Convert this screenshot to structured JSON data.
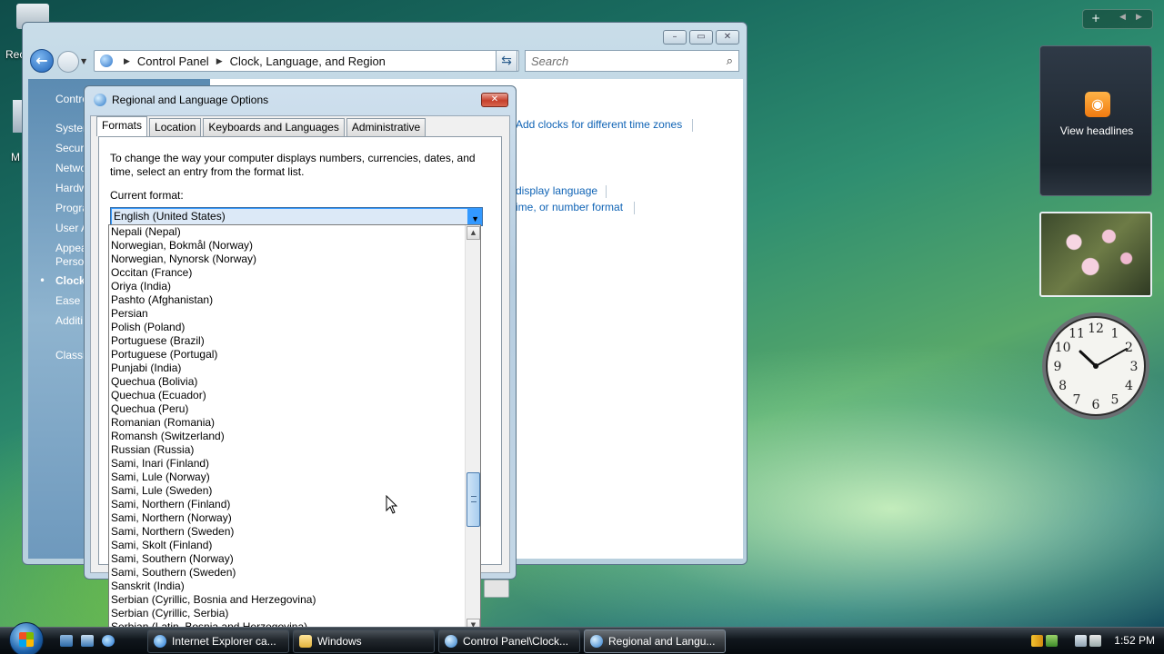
{
  "desktop": {
    "recycle_bin_label": "Rec",
    "icon2_label": "M"
  },
  "explorer": {
    "address": {
      "segments": [
        "Control Panel",
        "Clock, Language, and Region"
      ]
    },
    "search_placeholder": "Search",
    "left_pane": {
      "items": [
        {
          "label": "Contro"
        },
        {
          "label": "Syster"
        },
        {
          "label": "Securi"
        },
        {
          "label": "Netwo"
        },
        {
          "label": "Hardw"
        },
        {
          "label": "Progra"
        },
        {
          "label": "User A"
        },
        {
          "label": "Appea"
        },
        {
          "label": "Persor"
        },
        {
          "label": "Clock,"
        },
        {
          "label": "Ease o"
        },
        {
          "label": "Additi"
        },
        {
          "label": "Classi"
        }
      ]
    },
    "content_links": {
      "add_clocks": "Add clocks for different time zones",
      "display_language": "display language",
      "number_format": "ime, or number format"
    }
  },
  "dialog": {
    "title": "Regional and Language Options",
    "tabs": [
      "Formats",
      "Location",
      "Keyboards and Languages",
      "Administrative"
    ],
    "description": "To change the way your computer displays numbers, currencies, dates, and time, select an entry from the format list.",
    "current_format_label": "Current format:",
    "current_format_value": "English (United States)"
  },
  "format_list": {
    "options": [
      "Nepali (Nepal)",
      "Norwegian, Bokmål (Norway)",
      "Norwegian, Nynorsk (Norway)",
      "Occitan (France)",
      "Oriya (India)",
      "Pashto (Afghanistan)",
      "Persian",
      "Polish (Poland)",
      "Portuguese (Brazil)",
      "Portuguese (Portugal)",
      "Punjabi (India)",
      "Quechua (Bolivia)",
      "Quechua (Ecuador)",
      "Quechua (Peru)",
      "Romanian (Romania)",
      "Romansh (Switzerland)",
      "Russian (Russia)",
      "Sami, Inari (Finland)",
      "Sami, Lule (Norway)",
      "Sami, Lule (Sweden)",
      "Sami, Northern (Finland)",
      "Sami, Northern (Norway)",
      "Sami, Northern (Sweden)",
      "Sami, Skolt (Finland)",
      "Sami, Southern (Norway)",
      "Sami, Southern (Sweden)",
      "Sanskrit (India)",
      "Serbian (Cyrillic, Bosnia and Herzegovina)",
      "Serbian (Cyrillic, Serbia)",
      "Serbian (Latin, Bosnia and Herzegovina)"
    ]
  },
  "gadgets": {
    "feed_label": "View headlines",
    "clock_numbers": [
      "12",
      "1",
      "2",
      "3",
      "4",
      "5",
      "6",
      "7",
      "8",
      "9",
      "10",
      "11"
    ]
  },
  "taskbar": {
    "buttons": [
      {
        "label": "Internet Explorer ca..."
      },
      {
        "label": "Windows"
      },
      {
        "label": "Control Panel\\Clock..."
      },
      {
        "label": "Regional and Langu..."
      }
    ],
    "time": "1:52 PM"
  },
  "colors": {
    "link": "#0f63b5",
    "selection": "#3399ff",
    "close_button": "#c6402c"
  }
}
